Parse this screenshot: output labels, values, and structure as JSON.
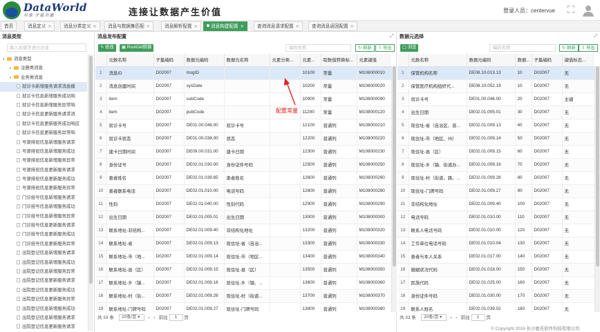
{
  "header": {
    "brand": "DataWorld",
    "brand_sub": "共享 才能共赢",
    "slogan": "连接让数据产生价值",
    "login_label": "登录人员：",
    "login_user": "centervue",
    "expand_icon": "fullscreen-icon",
    "user_icon": "user-icon"
  },
  "tabs": [
    {
      "label": "首页"
    },
    {
      "label": "消息定义"
    },
    {
      "label": "消息分类定义"
    },
    {
      "label": "消息与数据集匹配"
    },
    {
      "label": "消息解析配置"
    },
    {
      "label": "消息构建配置",
      "active": true
    },
    {
      "label": "查询消息请求配置"
    },
    {
      "label": "查询消息返回配置"
    }
  ],
  "left": {
    "title": "消息类型",
    "search_placeholder": "输入关键字进行过滤",
    "tree": [
      {
        "label": "消息类型",
        "level": 0,
        "type": "folder",
        "caret": "▾"
      },
      {
        "label": "注册类消息",
        "level": 1,
        "type": "folder",
        "caret": "▸"
      },
      {
        "label": "业务类消息",
        "level": 1,
        "type": "folder",
        "caret": "▾"
      },
      {
        "label": "就诊卡新增服务请求消息模",
        "level": 2,
        "type": "file",
        "selected": true
      },
      {
        "label": "就诊卡信息新增服务成功响",
        "level": 2,
        "type": "file"
      },
      {
        "label": "就诊卡信息新增服务异常响",
        "level": 2,
        "type": "file"
      },
      {
        "label": "就诊卡信息更新服务请求消",
        "level": 2,
        "type": "file"
      },
      {
        "label": "就诊卡信息更新服务成功响应",
        "level": 2,
        "type": "file"
      },
      {
        "label": "就诊卡信息更新服务异常响",
        "level": 2,
        "type": "file"
      },
      {
        "label": "号源排班信息新增服务请求",
        "level": 2,
        "type": "file"
      },
      {
        "label": "号源排班信息新增服务成功",
        "level": 2,
        "type": "file"
      },
      {
        "label": "号源排班信息新增服务异常",
        "level": 2,
        "type": "file"
      },
      {
        "label": "号源排班信息更新服务请求",
        "level": 2,
        "type": "file"
      },
      {
        "label": "号源排班信息更新服务成功",
        "level": 2,
        "type": "file"
      },
      {
        "label": "号源排班信息更新服务异常",
        "level": 2,
        "type": "file"
      },
      {
        "label": "门诊挂号信息新增服务请求",
        "level": 2,
        "type": "file"
      },
      {
        "label": "门诊挂号信息新增服务成功",
        "level": 2,
        "type": "file"
      },
      {
        "label": "门诊挂号信息新增服务异常",
        "level": 2,
        "type": "file"
      },
      {
        "label": "门诊挂号信息更新服务请求",
        "level": 2,
        "type": "file"
      },
      {
        "label": "门诊挂号信息更新服务成功",
        "level": 2,
        "type": "file"
      },
      {
        "label": "门诊挂号信息更新服务异常",
        "level": 2,
        "type": "file"
      },
      {
        "label": "出院登记信息新增服务请求",
        "level": 2,
        "type": "file"
      },
      {
        "label": "出院登记信息新增服务成功",
        "level": 2,
        "type": "file"
      },
      {
        "label": "出院登记信息新增服务异常",
        "level": 2,
        "type": "file"
      },
      {
        "label": "出院登记信息更新服务请求",
        "level": 2,
        "type": "file"
      },
      {
        "label": "出院登记信息更新服务成功",
        "level": 2,
        "type": "file"
      },
      {
        "label": "出院登记信息更新服务异常",
        "level": 2,
        "type": "file"
      },
      {
        "label": "出院登记信息新增服务成功",
        "level": 2,
        "type": "file"
      },
      {
        "label": "出院登记信息新增服务请求",
        "level": 2,
        "type": "file"
      },
      {
        "label": "出院登记信息更新服务请求",
        "level": 2,
        "type": "file"
      },
      {
        "label": "出院登记信息更新服务成功",
        "level": 2,
        "type": "file"
      }
    ]
  },
  "mid": {
    "title": "消息发布配置",
    "edit_label": "修改",
    "root_label": "RootOid转换",
    "search_placeholder": "编码名称",
    "refresh_label": "刷新",
    "export_label": "导出",
    "columns": [
      "",
      "元数名称",
      "子集编码",
      "数据元编码",
      "数据元名称",
      "元素分类...",
      "元素...",
      "取数值转换标...",
      "元素键值"
    ],
    "rows": [
      [
        "1",
        "消息ID",
        "D02007",
        "msgID",
        "",
        "",
        "10100",
        "常量",
        "M108000010"
      ],
      [
        "2",
        "消息创建时间",
        "D02007",
        "sysDate",
        "",
        "",
        "10200",
        "常量",
        "M108000020"
      ],
      [
        "3",
        "item",
        "D02007",
        "subCode",
        "",
        "",
        "10900",
        "常量",
        "M108000090"
      ],
      [
        "4",
        "item",
        "D02007",
        "pubCode",
        "",
        "",
        "11200",
        "常量",
        "M108000120"
      ],
      [
        "5",
        "就诊卡号",
        "D02007",
        "DE01.00.046.00",
        "就诊卡号",
        "",
        "12100",
        "普通列",
        "M108000210"
      ],
      [
        "6",
        "就诊卡状态",
        "D02007",
        "DE01.00.038.00",
        "状态",
        "",
        "12200",
        "普通列",
        "M108000220"
      ],
      [
        "7",
        "建卡日期时间",
        "D02007",
        "DE09.00.031.00",
        "建卡日期",
        "",
        "12300",
        "普通列",
        "M108000230"
      ],
      [
        "8",
        "身份证号",
        "D02007",
        "DE02.01.030.00",
        "身份证件号码",
        "",
        "12500",
        "普通列",
        "M108000250"
      ],
      [
        "9",
        "患者姓名",
        "D02007",
        "DE02.01.039.65",
        "患者姓名",
        "",
        "12600",
        "普通列",
        "M108000260"
      ],
      [
        "10",
        "患者联系电话",
        "D02007",
        "DE02.01.010.00",
        "电话号码",
        "",
        "12800",
        "普通列",
        "M108000280"
      ],
      [
        "11",
        "性别",
        "D02007",
        "DE02.01.040.00",
        "性别代码",
        "",
        "12900",
        "普通列",
        "M108000290"
      ],
      [
        "12",
        "出生日期",
        "D02007",
        "DE02.01.005.01",
        "出生日期",
        "",
        "13000",
        "普通列",
        "M108000300"
      ],
      [
        "13",
        "联系地址-非结构...",
        "D02007",
        "DE02.01.009.40",
        "非结构化地址",
        "",
        "13200",
        "普通列",
        "M108000320"
      ],
      [
        "14",
        "联系地址-省",
        "D02007",
        "DE02.01.009.13",
        "现住址-省（自治...",
        "",
        "13300",
        "普通列",
        "M108000330"
      ],
      [
        "15",
        "联系地址-市（地...",
        "D02007",
        "DE02.01.009.14",
        "现住址-市（地区...",
        "",
        "13400",
        "普通列",
        "M108000340"
      ],
      [
        "16",
        "联系地址-县（区）",
        "D02007",
        "DE02.01.009.15",
        "现住址-县（区）",
        "",
        "13500",
        "普通列",
        "M108000350"
      ],
      [
        "17",
        "联系地址-乡（镇...",
        "D02007",
        "DE02.01.009.16",
        "现住址-乡（镇、...",
        "",
        "13600",
        "普通列",
        "M108000360"
      ],
      [
        "18",
        "联系地址-村（街...",
        "D02007",
        "DE02.01.009.26",
        "现住址-村（街道...",
        "",
        "13700",
        "普通列",
        "M108000370"
      ],
      [
        "19",
        "联系地址-门牌号码",
        "D02007",
        "DE02.01.009.27",
        "现住址-门牌号码",
        "",
        "13800",
        "普通列",
        "M108000380"
      ]
    ],
    "annotation": "配置常量",
    "pager": {
      "total": "共 33 条",
      "page_size": "20条/页",
      "goto": "前往",
      "page": "1",
      "unit": "页",
      "prev": "‹",
      "next": "›"
    }
  },
  "right": {
    "title": "数据元选择",
    "browse_label": "浏览",
    "search_placeholder": "编码名称",
    "refresh_label": "刷新",
    "export_label": "导出",
    "columns": [
      "",
      "元数名称",
      "数据元编码",
      "数据...",
      "子集编码",
      "键值标志..."
    ],
    "rows": [
      [
        "1",
        "保管机构名称",
        "DE08.10.013.13",
        "10",
        "D02007",
        "无"
      ],
      [
        "2",
        "保管医疗机构组织代...",
        "DE08.10.052.19",
        "10",
        "D02007",
        "无"
      ],
      [
        "3",
        "就诊卡号",
        "DE01.00.046.00",
        "20",
        "D02007",
        "主键"
      ],
      [
        "4",
        "出生日期",
        "DE02.01.005.01",
        "30",
        "D02007",
        "无"
      ],
      [
        "5",
        "现住址-省（自治区、直...",
        "DE02.01.009.13",
        "40",
        "D02007",
        "无"
      ],
      [
        "6",
        "现住址-市（地区、州）",
        "DE02.01.009.14",
        "50",
        "D02007",
        "无"
      ],
      [
        "7",
        "现住址-县（区）",
        "DE02.01.009.15",
        "60",
        "D02007",
        "无"
      ],
      [
        "8",
        "现住址-乡（镇、街道办...",
        "DE02.01.009.16",
        "70",
        "D02007",
        "无"
      ],
      [
        "9",
        "现住址-村（街道、路、...",
        "DE02.01.009.26",
        "80",
        "D02007",
        "无"
      ],
      [
        "10",
        "现住址-门牌号码",
        "DE02.01.009.27",
        "90",
        "D02007",
        "无"
      ],
      [
        "11",
        "非结构化地址",
        "DE02.01.009.40",
        "100",
        "D02007",
        "无"
      ],
      [
        "12",
        "电话号码",
        "DE02.01.010.00",
        "110",
        "D02007",
        "无"
      ],
      [
        "13",
        "联系人电话号码",
        "DE02.01.010.00",
        "120",
        "D02007",
        "无"
      ],
      [
        "14",
        "工作单位电话号码",
        "DE02.01.010.04",
        "130",
        "D02007",
        "无"
      ],
      [
        "15",
        "患者与本人关系",
        "DE02.01.017.00",
        "140",
        "D02007",
        "无"
      ],
      [
        "16",
        "婚姻状况代码",
        "DE02.01.018.00",
        "150",
        "D02007",
        "无"
      ],
      [
        "17",
        "民族代码",
        "DE02.01.025.00",
        "160",
        "D02007",
        "无"
      ],
      [
        "18",
        "身份证件号码",
        "DE02.01.030.00",
        "170",
        "D02007",
        "无"
      ],
      [
        "19",
        "联系人姓名",
        "DE02.01.039.02",
        "180",
        "D02007",
        "无"
      ]
    ],
    "pager": {
      "total": "共 33 条",
      "page_size": "20条/页",
      "goto": "前往",
      "page": "1",
      "unit": "页",
      "prev": "‹",
      "next": "›"
    }
  },
  "footer": "© Copyright 2016 长沙娄氏软件科技有限公司",
  "colors": {
    "accent": "#3f9d5c",
    "highlight_row": "#dbe8f7",
    "annotation": "#e02020"
  }
}
